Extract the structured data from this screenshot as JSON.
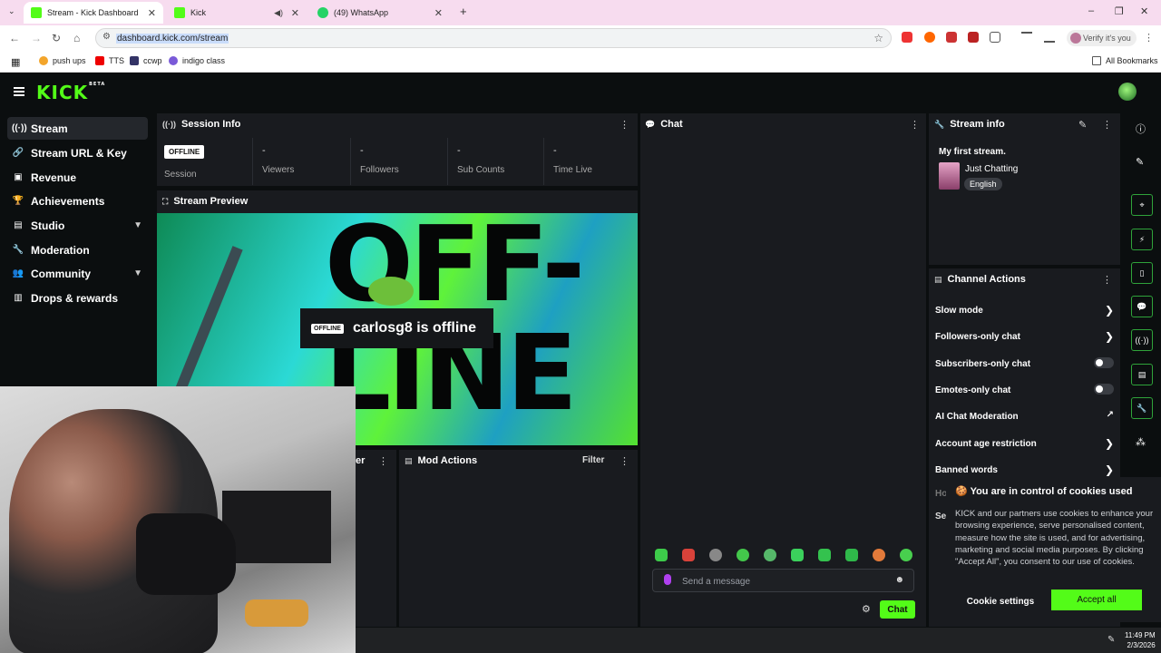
{
  "browser": {
    "tabs": [
      {
        "title": "Stream - Kick Dashboard",
        "color": "#53fc18"
      },
      {
        "title": "Kick",
        "color": "#53fc18"
      },
      {
        "title": "(49) WhatsApp",
        "color": "#25d366"
      }
    ],
    "url": "dashboard.kick.com/stream",
    "verify_label": "Verify it's you",
    "bookmarks": [
      "push ups",
      "TTS",
      "ccwp",
      "indigo class"
    ],
    "all_bookmarks": "All Bookmarks"
  },
  "kick": {
    "logo": "KICK",
    "logo_sup": "BETA",
    "accent": "#53fc18"
  },
  "sidebar": {
    "items": [
      {
        "label": "Stream",
        "icon": "broadcast-icon"
      },
      {
        "label": "Stream URL & Key",
        "icon": "link-icon"
      },
      {
        "label": "Revenue",
        "icon": "money-icon"
      },
      {
        "label": "Achievements",
        "icon": "trophy-icon"
      },
      {
        "label": "Studio",
        "icon": "studio-icon"
      },
      {
        "label": "Moderation",
        "icon": "wrench-icon"
      },
      {
        "label": "Community",
        "icon": "community-icon"
      },
      {
        "label": "Drops & rewards",
        "icon": "drops-icon"
      }
    ]
  },
  "session": {
    "title": "Session Info",
    "badge": "OFFLINE",
    "session_label": "Session",
    "stats": [
      {
        "value": "-",
        "label": "Viewers"
      },
      {
        "value": "-",
        "label": "Followers"
      },
      {
        "value": "-",
        "label": "Sub Counts"
      },
      {
        "value": "-",
        "label": "Time Live"
      }
    ]
  },
  "preview": {
    "title": "Stream Preview",
    "big_text_top": "OFF-",
    "big_text_bottom": "LINE",
    "badge": "OFFLINE",
    "status": "carlosg8 is offline"
  },
  "mod": {
    "title": "Mod Actions",
    "filter": "Filter",
    "partial": "er"
  },
  "chat": {
    "title": "Chat",
    "placeholder": "Send a message",
    "send": "Chat"
  },
  "stream_info": {
    "title": "Stream info",
    "stream_title": "My first stream.",
    "category": "Just Chatting",
    "language": "English"
  },
  "channel_actions": {
    "title": "Channel Actions",
    "rows": [
      {
        "label": "Slow mode",
        "control": "chevron"
      },
      {
        "label": "Followers-only chat",
        "control": "chevron"
      },
      {
        "label": "Subscribers-only chat",
        "control": "toggle"
      },
      {
        "label": "Emotes-only chat",
        "control": "toggle"
      },
      {
        "label": "AI Chat Moderation",
        "control": "external"
      },
      {
        "label": "Account age restriction",
        "control": "chevron"
      },
      {
        "label": "Banned words",
        "control": "chevron"
      }
    ],
    "partial_1": "Ho",
    "partial_2": "Se"
  },
  "cookie": {
    "title": "You are in control of cookies used",
    "body": "KICK and our partners use cookies to enhance your browsing experience, serve personalised content, measure how the site is used, and for advertising, marketing and social media purposes. By clicking \"Accept All\", you consent to our use of cookies.",
    "settings": "Cookie settings",
    "accept": "Accept all"
  },
  "taskbar": {
    "time": "11:49 PM",
    "date": "2/3/2026"
  }
}
